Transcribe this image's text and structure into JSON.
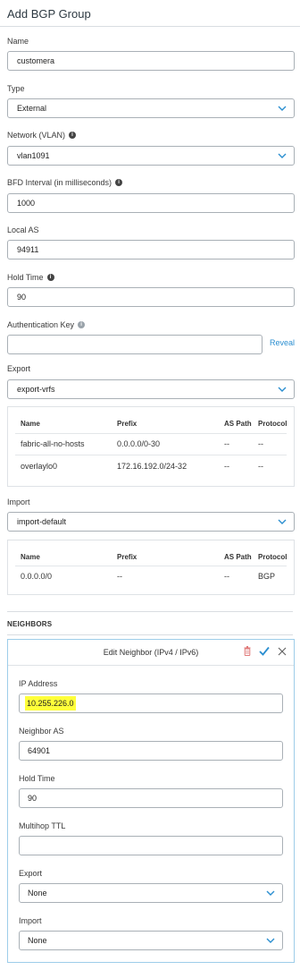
{
  "header": {
    "title": "Add BGP Group"
  },
  "form": {
    "name": {
      "label": "Name",
      "value": "customera"
    },
    "type": {
      "label": "Type",
      "value": "External"
    },
    "network": {
      "label": "Network (VLAN)",
      "value": "vlan1091"
    },
    "bfd": {
      "label": "BFD Interval (in milliseconds)",
      "value": "1000"
    },
    "local_as": {
      "label": "Local AS",
      "value": "94911"
    },
    "hold_time": {
      "label": "Hold Time",
      "value": "90"
    },
    "auth_key": {
      "label": "Authentication Key",
      "value": "",
      "reveal": "Reveal"
    },
    "export": {
      "label": "Export",
      "value": "export-vrfs"
    },
    "import": {
      "label": "Import",
      "value": "import-default"
    }
  },
  "export_table": {
    "headers": [
      "Name",
      "Prefix",
      "AS Path",
      "Protocol"
    ],
    "rows": [
      [
        "fabric-all-no-hosts",
        "0.0.0.0/0-30",
        "--",
        "--"
      ],
      [
        "overlaylo0",
        "172.16.192.0/24-32",
        "--",
        "--"
      ]
    ]
  },
  "import_table": {
    "headers": [
      "Name",
      "Prefix",
      "AS Path",
      "Protocol"
    ],
    "rows": [
      [
        "0.0.0.0/0",
        "--",
        "--",
        "BGP"
      ]
    ]
  },
  "neighbors": {
    "section_title": "NEIGHBORS",
    "panel_title": "Edit Neighbor (IPv4 / IPv6)",
    "ip_address": {
      "label": "IP Address",
      "value": "10.255.226.0"
    },
    "neighbor_as": {
      "label": "Neighbor AS",
      "value": "64901"
    },
    "hold_time": {
      "label": "Hold Time",
      "value": "90"
    },
    "multihop_ttl": {
      "label": "Multihop TTL",
      "value": ""
    },
    "export": {
      "label": "Export",
      "value": "None"
    },
    "import": {
      "label": "Import",
      "value": "None"
    }
  },
  "colors": {
    "accent": "#2a8ed0",
    "highlight": "#ffff3a",
    "border": "#a9b0b6"
  }
}
